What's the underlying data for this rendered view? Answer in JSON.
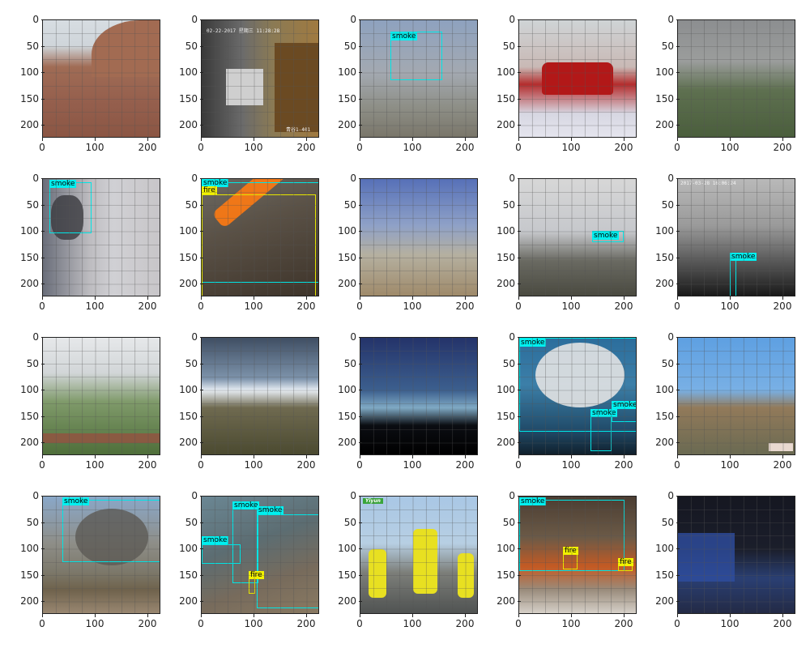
{
  "axes": {
    "x_ticks": [
      "0",
      "100",
      "200"
    ],
    "y_ticks": [
      "0",
      "50",
      "100",
      "150",
      "200"
    ]
  },
  "labels": {
    "smoke": "smoke",
    "fire": "fire"
  },
  "panels": [
    {
      "id": "p1",
      "scene": "barren hillside",
      "boxes": []
    },
    {
      "id": "p2",
      "scene": "cctv room",
      "overlay_texts": [
        "02-22-2017 星期三 11:28:28",
        "青谷1-401"
      ],
      "boxes": []
    },
    {
      "id": "p3",
      "scene": "blurry sky",
      "boxes": [
        {
          "type": "smoke"
        }
      ]
    },
    {
      "id": "p4",
      "scene": "red car at event",
      "boxes": []
    },
    {
      "id": "p5",
      "scene": "aerial landscape",
      "boxes": []
    },
    {
      "id": "p6",
      "scene": "building with smoke",
      "boxes": [
        {
          "type": "smoke"
        }
      ]
    },
    {
      "id": "p7",
      "scene": "forest fire",
      "boxes": [
        {
          "type": "smoke"
        },
        {
          "type": "fire"
        }
      ]
    },
    {
      "id": "p8",
      "scene": "sky and terrain",
      "boxes": []
    },
    {
      "id": "p9",
      "scene": "tower view",
      "boxes": [
        {
          "type": "smoke"
        }
      ]
    },
    {
      "id": "p10",
      "scene": "misty mountains",
      "overlay_texts": [
        "2017-03-28  16:06:24"
      ],
      "boxes": [
        {
          "type": "smoke"
        }
      ]
    },
    {
      "id": "p11",
      "scene": "road through trees",
      "boxes": []
    },
    {
      "id": "p12",
      "scene": "horizon blur",
      "boxes": []
    },
    {
      "id": "p13",
      "scene": "dark mountains",
      "boxes": []
    },
    {
      "id": "p14",
      "scene": "industrial smoke",
      "boxes": [
        {
          "type": "smoke"
        },
        {
          "type": "smoke"
        },
        {
          "type": "smoke"
        }
      ]
    },
    {
      "id": "p15",
      "scene": "scaffold workers",
      "boxes": []
    },
    {
      "id": "p16",
      "scene": "field smoke",
      "boxes": [
        {
          "type": "smoke"
        }
      ]
    },
    {
      "id": "p17",
      "scene": "smoke and fire blurred",
      "boxes": [
        {
          "type": "smoke"
        },
        {
          "type": "smoke"
        },
        {
          "type": "smoke"
        },
        {
          "type": "fire"
        }
      ]
    },
    {
      "id": "p18",
      "scene": "workers in vests",
      "badge": "Yiyun",
      "boxes": []
    },
    {
      "id": "p19",
      "scene": "fire over crowd",
      "boxes": [
        {
          "type": "smoke"
        },
        {
          "type": "fire"
        },
        {
          "type": "fire"
        }
      ]
    },
    {
      "id": "p20",
      "scene": "auditorium",
      "boxes": []
    }
  ]
}
